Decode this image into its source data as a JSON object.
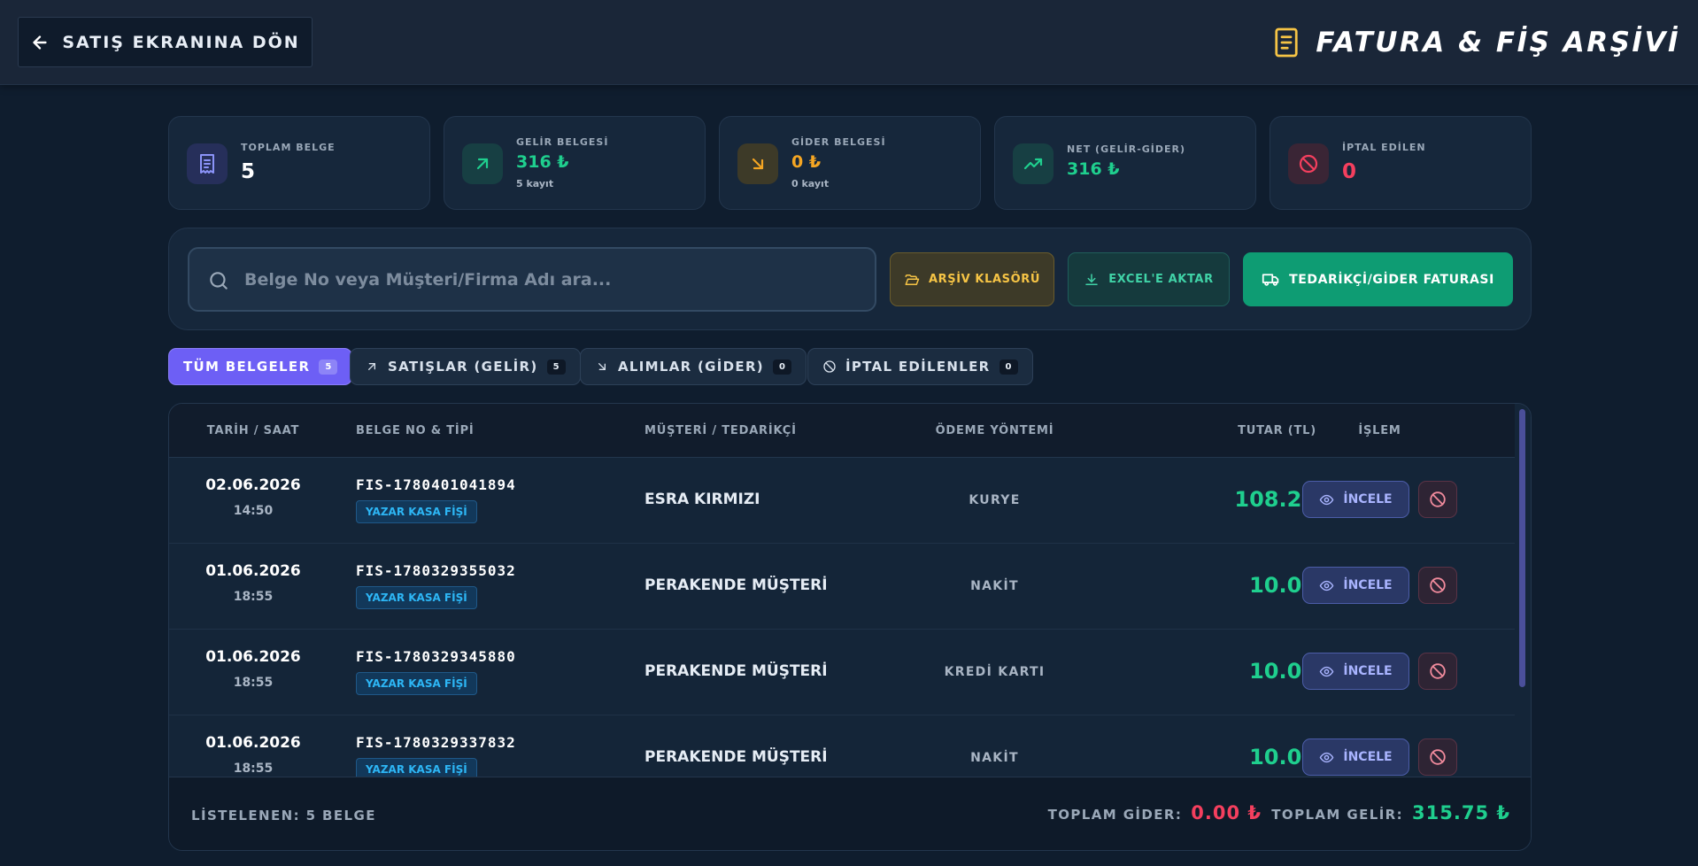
{
  "header": {
    "back_label": "SATIŞ EKRANINA DÖN",
    "title": "FATURA & FİŞ ARŞİVİ"
  },
  "stats": [
    {
      "label": "TOPLAM BELGE",
      "value": "5",
      "sub": "",
      "color": "#ffffff",
      "icon": "receipt-icon"
    },
    {
      "label": "GELİR BELGESİ",
      "value": "316 ₺",
      "sub": "5 kayıt",
      "color": "#1fcf8e",
      "icon": "arrow-up-right-icon"
    },
    {
      "label": "GİDER BELGESİ",
      "value": "0 ₺",
      "sub": "0 kayıt",
      "color": "#f5a623",
      "icon": "arrow-down-right-icon"
    },
    {
      "label": "NET (GELİR-GİDER)",
      "value": "316 ₺",
      "sub": "",
      "color": "#1fcf8e",
      "icon": "trending-up-icon"
    },
    {
      "label": "İPTAL EDİLEN",
      "value": "0",
      "sub": "",
      "color": "#f43f5e",
      "icon": "ban-icon"
    }
  ],
  "search": {
    "placeholder": "Belge No veya Müşteri/Firma Adı ara...",
    "value": ""
  },
  "toolbar": {
    "archive_label": "ARŞİV KLASÖRÜ",
    "excel_label": "EXCEL'E AKTAR",
    "supplier_label": "TEDARİKÇİ/GİDER FATURASI"
  },
  "tabs": [
    {
      "label": "TÜM BELGELER",
      "count": "5",
      "active": true
    },
    {
      "label": "SATIŞLAR (GELİR)",
      "count": "5",
      "active": false
    },
    {
      "label": "ALIMLAR (GİDER)",
      "count": "0",
      "active": false
    },
    {
      "label": "İPTAL EDİLENLER",
      "count": "0",
      "active": false
    }
  ],
  "table": {
    "columns": [
      "TARİH / SAAT",
      "BELGE NO & TİPİ",
      "MÜŞTERİ / TEDARİKÇİ",
      "ÖDEME YÖNTEMİ",
      "TUTAR (TL)",
      "İŞLEM"
    ],
    "inspect_label": "İNCELE",
    "rows": [
      {
        "date": "02.06.2026",
        "time": "14:50",
        "doc_no": "FIS-1780401041894",
        "doc_type": "YAZAR KASA FİŞİ",
        "customer": "ESRA KIRMIZI",
        "payment": "KURYE",
        "amount": "108.25"
      },
      {
        "date": "01.06.2026",
        "time": "18:55",
        "doc_no": "FIS-1780329355032",
        "doc_type": "YAZAR KASA FİŞİ",
        "customer": "PERAKENDE MÜŞTERİ",
        "payment": "NAKİT",
        "amount": "10.00"
      },
      {
        "date": "01.06.2026",
        "time": "18:55",
        "doc_no": "FIS-1780329345880",
        "doc_type": "YAZAR KASA FİŞİ",
        "customer": "PERAKENDE MÜŞTERİ",
        "payment": "KREDİ KARTI",
        "amount": "10.00"
      },
      {
        "date": "01.06.2026",
        "time": "18:55",
        "doc_no": "FIS-1780329337832",
        "doc_type": "YAZAR KASA FİŞİ",
        "customer": "PERAKENDE MÜŞTERİ",
        "payment": "NAKİT",
        "amount": "10.00"
      }
    ]
  },
  "footer": {
    "listed": "LİSTELENEN: 5 BELGE",
    "expense_label": "TOPLAM GİDER:",
    "expense_value": "0.00 ₺",
    "income_label": "TOPLAM GELİR:",
    "income_value": "315.75 ₺"
  },
  "colors": {
    "accent": "#6d5ff5",
    "income": "#1fcf8e",
    "expense": "#f43f5e",
    "warning": "#f6c445"
  }
}
